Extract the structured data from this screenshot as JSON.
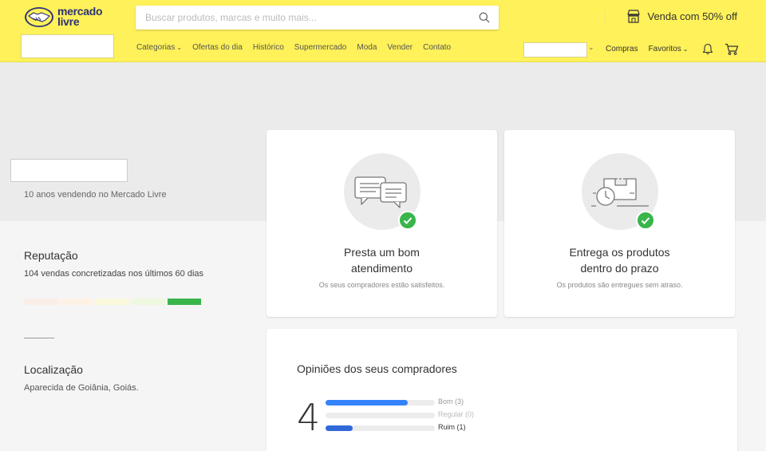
{
  "header": {
    "logo_text_line1": "mercado",
    "logo_text_line2": "livre",
    "search_placeholder": "Buscar produtos, marcas e muito mais...",
    "promo_label": "Venda com 50% off",
    "nav": [
      {
        "label": "Categorias",
        "dropdown": true
      },
      {
        "label": "Ofertas do dia"
      },
      {
        "label": "Histórico"
      },
      {
        "label": "Supermercado"
      },
      {
        "label": "Moda"
      },
      {
        "label": "Vender"
      },
      {
        "label": "Contato"
      }
    ],
    "right_nav": {
      "compras": "Compras",
      "favoritos": "Favoritos"
    }
  },
  "seller": {
    "years_text": "10 anos vendendo no Mercado Livre"
  },
  "reputation": {
    "title": "Reputação",
    "subtitle": "104 vendas concretizadas nos últimos 60 dias",
    "thermometer_levels": 5,
    "thermometer_active_level": 5,
    "colors": [
      "#fbeee8",
      "#fdf2e4",
      "#fbf9dc",
      "#edf8df",
      "#39b54a"
    ]
  },
  "location": {
    "title": "Localização",
    "value": "Aparecida de Goiânia, Goiás."
  },
  "cards": [
    {
      "title": "Presta um bom atendimento",
      "subtitle": "Os seus compradores estão satisfeitos.",
      "icon": "chat-bubbles-icon"
    },
    {
      "title": "Entrega os produtos dentro do prazo",
      "subtitle": "Os produtos são entregues sem atraso.",
      "icon": "delivery-clock-icon"
    }
  ],
  "opinions": {
    "title": "Opiniões dos seus compradores",
    "score": "4",
    "bars": [
      {
        "label": "Bom (3)",
        "fraction": 0.75,
        "color": "#3483fa",
        "label_color": "#999"
      },
      {
        "label": "Regular (0)",
        "fraction": 0,
        "color": "#3483fa",
        "label_color": "#bbb"
      },
      {
        "label": "Ruim (1)",
        "fraction": 0.25,
        "color": "#3168d8",
        "label_color": "#333"
      }
    ]
  },
  "colors": {
    "header_bg": "#fff159",
    "accent_blue": "#3483fa",
    "check_green": "#39b54a"
  }
}
